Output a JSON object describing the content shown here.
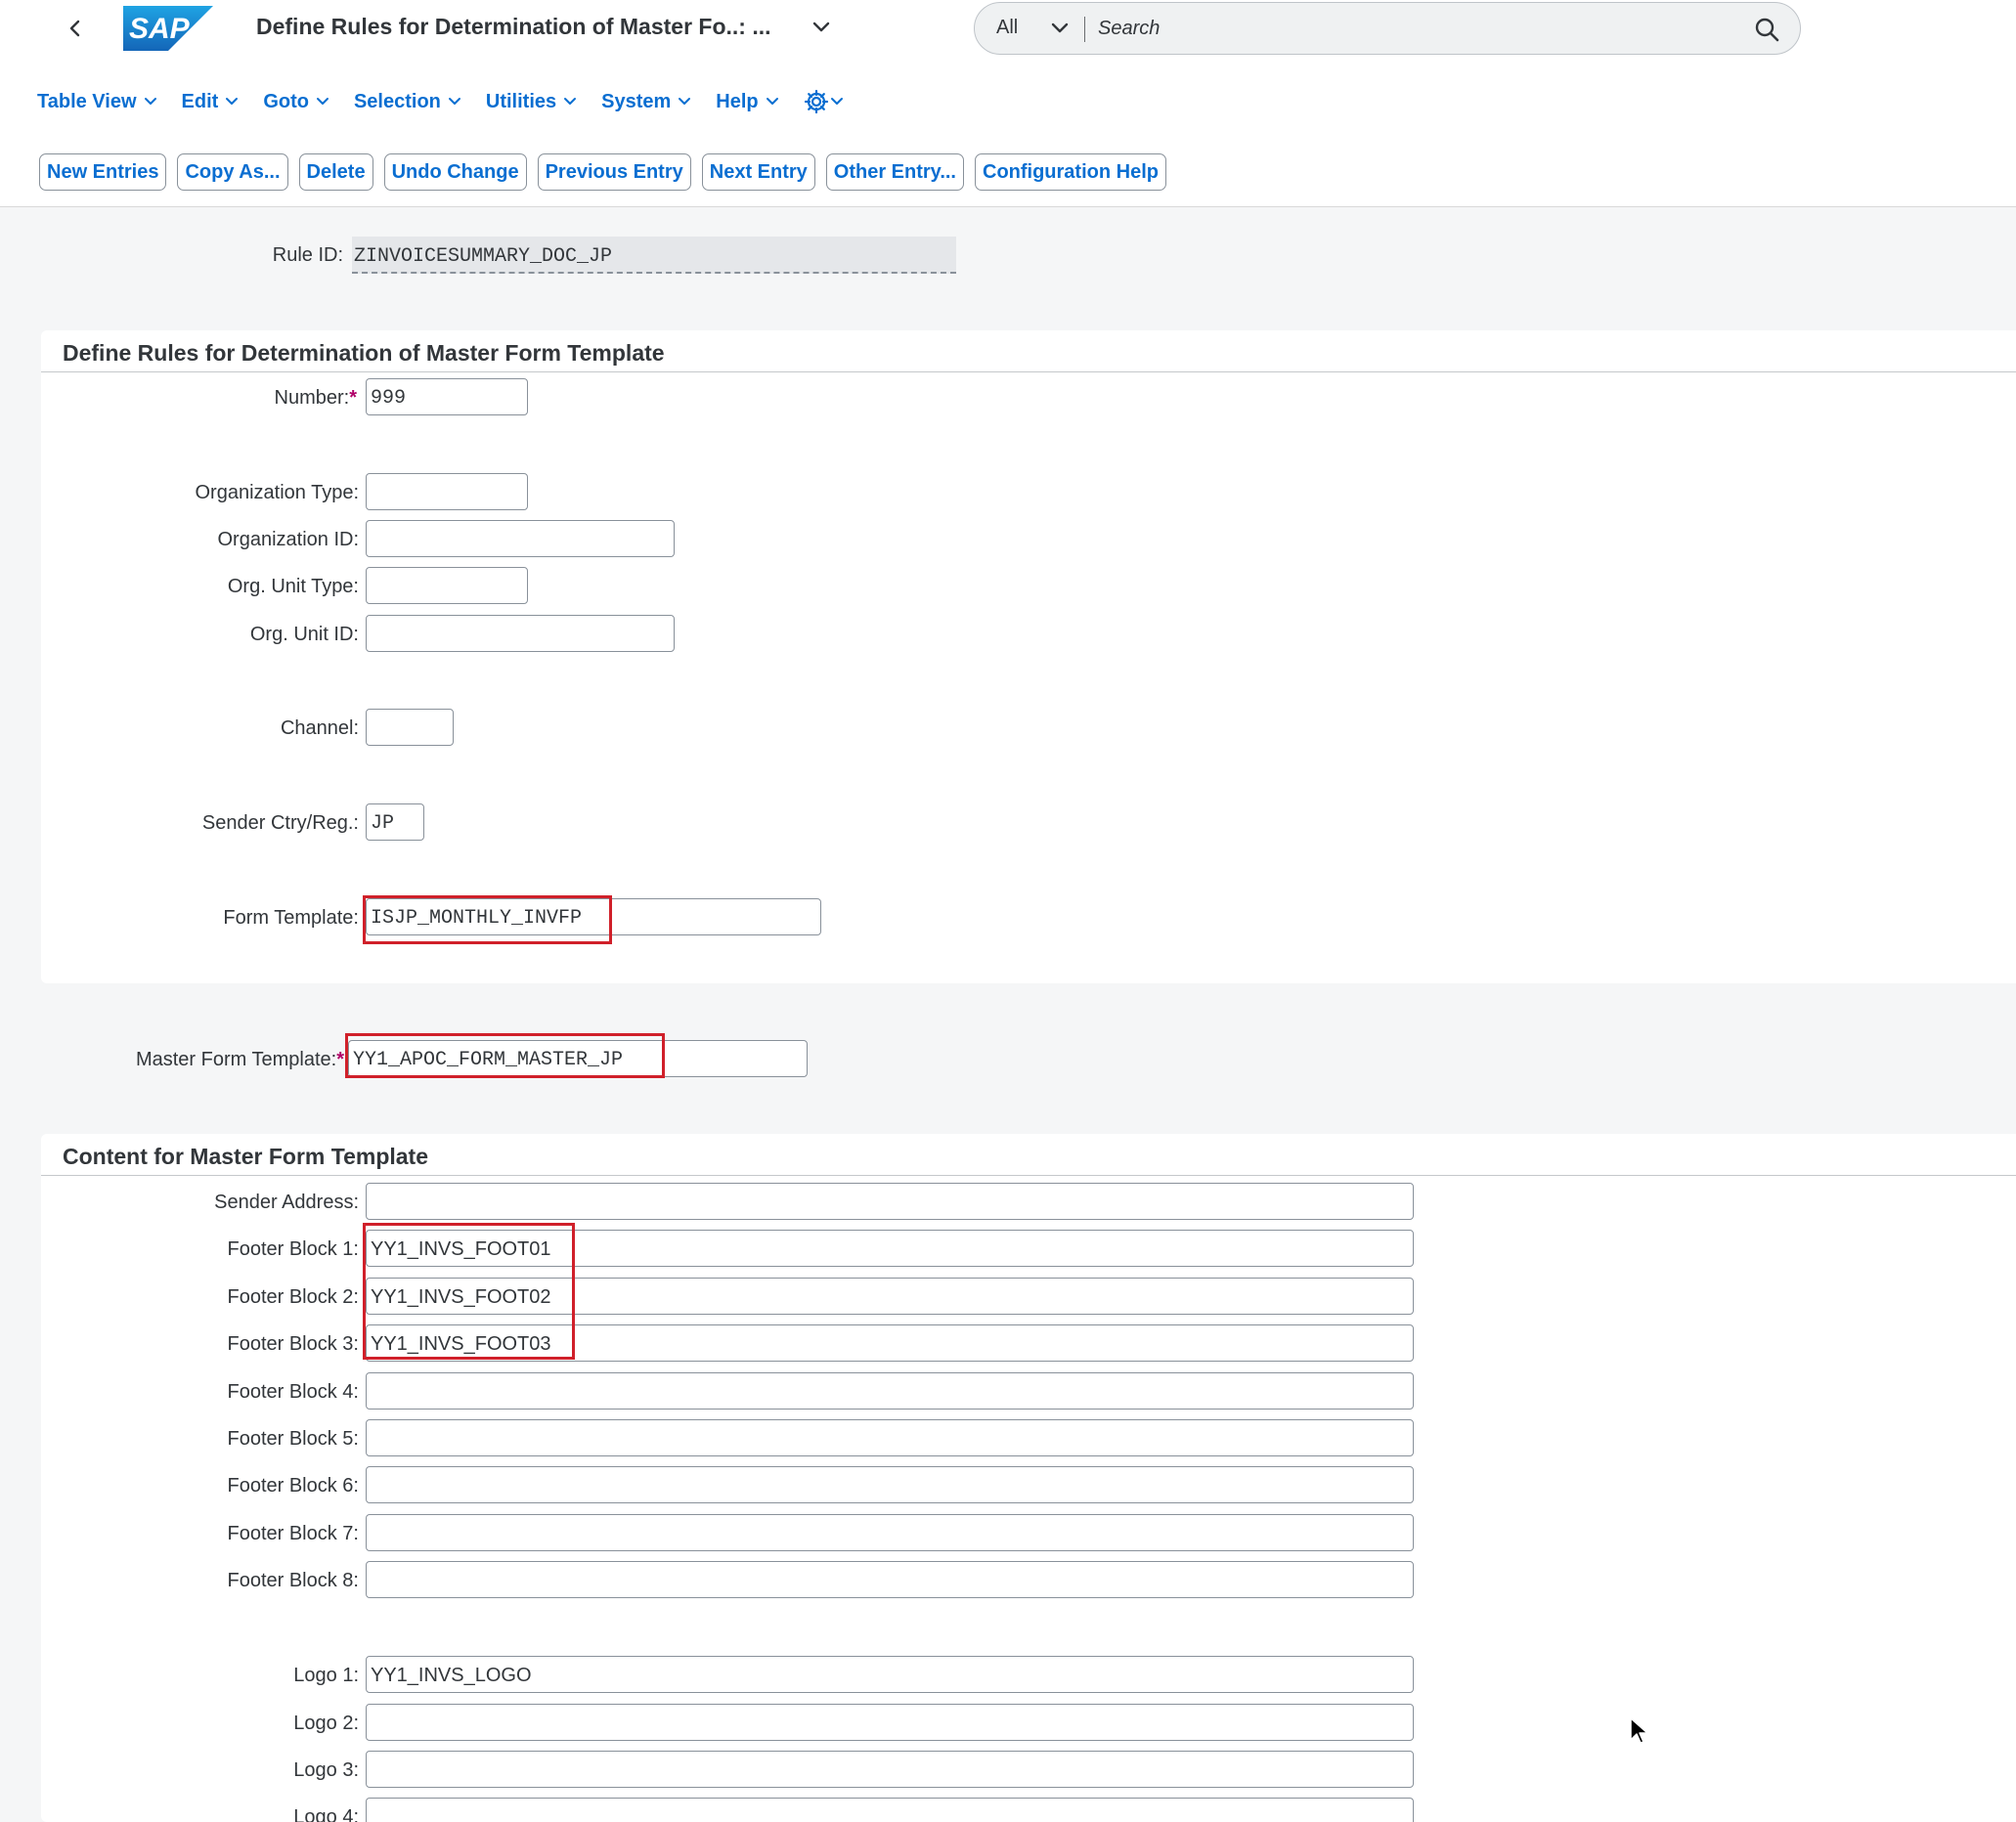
{
  "shell": {
    "title": "Define Rules for Determination of Master Fo..: ...",
    "logo_text": "SAP",
    "search_scope": "All",
    "search_placeholder": "Search"
  },
  "menu": [
    "Table View",
    "Edit",
    "Goto",
    "Selection",
    "Utilities",
    "System",
    "Help"
  ],
  "toolbar": [
    "New Entries",
    "Copy As...",
    "Delete",
    "Undo Change",
    "Previous Entry",
    "Next Entry",
    "Other Entry...",
    "Configuration Help"
  ],
  "rule": {
    "label": "Rule ID:",
    "value": "ZINVOICESUMMARY_DOC_JP"
  },
  "section1": {
    "title": "Define Rules for Determination of Master Form Template",
    "number_label": "Number:",
    "number_value": "999",
    "org_type_label": "Organization Type:",
    "org_type_value": "",
    "org_id_label": "Organization ID:",
    "org_id_value": "",
    "org_unit_type_label": "Org. Unit Type:",
    "org_unit_type_value": "",
    "org_unit_id_label": "Org. Unit ID:",
    "org_unit_id_value": "",
    "channel_label": "Channel:",
    "channel_value": "",
    "sender_ctry_label": "Sender Ctry/Reg.:",
    "sender_ctry_value": "JP",
    "form_template_label": "Form Template:",
    "form_template_value": "ISJP_MONTHLY_INVFP"
  },
  "master": {
    "label": "Master Form Template:",
    "value": "YY1_APOC_FORM_MASTER_JP"
  },
  "section2": {
    "title": "Content for Master Form Template",
    "rows": [
      {
        "label": "Sender Address:",
        "value": ""
      },
      {
        "label": "Footer Block 1:",
        "value": "YY1_INVS_FOOT01"
      },
      {
        "label": "Footer Block 2:",
        "value": "YY1_INVS_FOOT02"
      },
      {
        "label": "Footer Block 3:",
        "value": "YY1_INVS_FOOT03"
      },
      {
        "label": "Footer Block 4:",
        "value": ""
      },
      {
        "label": "Footer Block 5:",
        "value": ""
      },
      {
        "label": "Footer Block 6:",
        "value": ""
      },
      {
        "label": "Footer Block 7:",
        "value": ""
      },
      {
        "label": "Footer Block 8:",
        "value": ""
      }
    ],
    "logos": [
      {
        "label": "Logo 1:",
        "value": "YY1_INVS_LOGO"
      },
      {
        "label": "Logo 2:",
        "value": ""
      },
      {
        "label": "Logo 3:",
        "value": ""
      },
      {
        "label": "Logo 4:",
        "value": ""
      }
    ]
  },
  "colors": {
    "accent": "#0a6ed1",
    "highlight": "#d0202a",
    "required": "#b00068",
    "sap_blue": "#1b79c8"
  },
  "icons": [
    "back-arrow-icon",
    "chevron-down-icon",
    "search-icon",
    "settings-gear-icon",
    "mouse-pointer-icon"
  ]
}
